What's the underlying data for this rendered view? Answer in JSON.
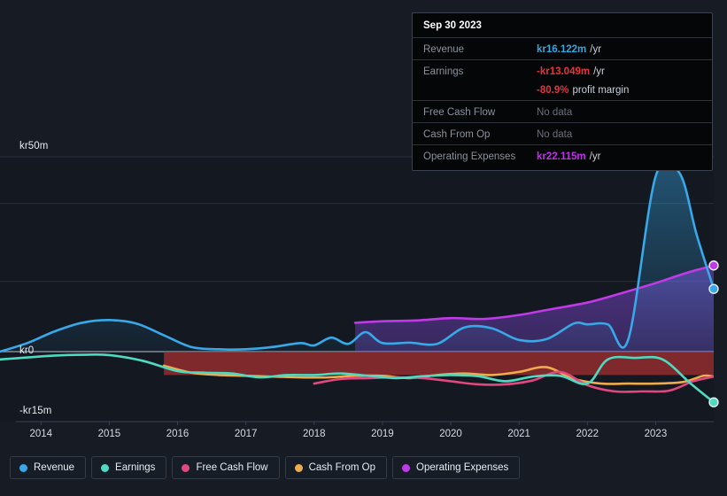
{
  "tooltip": {
    "date": "Sep 30 2023",
    "rows": [
      {
        "key": "Revenue",
        "value": "kr16.122m",
        "suffix": "/yr",
        "color": "#33a7e0",
        "nodata": false
      },
      {
        "key": "Earnings",
        "value": "-kr13.049m",
        "suffix": "/yr",
        "color": "#e8323c",
        "nodata": false
      },
      {
        "key": "",
        "value": "-80.9%",
        "suffix": "profit margin",
        "color": "#e8323c",
        "nodata": false,
        "continuation": true
      },
      {
        "key": "Free Cash Flow",
        "value": "No data",
        "suffix": "",
        "color": "#6a717b",
        "nodata": true
      },
      {
        "key": "Cash From Op",
        "value": "No data",
        "suffix": "",
        "color": "#6a717b",
        "nodata": true
      },
      {
        "key": "Operating Expenses",
        "value": "kr22.115m",
        "suffix": "/yr",
        "color": "#c030e8",
        "nodata": false
      }
    ]
  },
  "legend": [
    {
      "label": "Revenue",
      "color": "#38a8e8"
    },
    {
      "label": "Earnings",
      "color": "#4fd9c0"
    },
    {
      "label": "Free Cash Flow",
      "color": "#e0487f"
    },
    {
      "label": "Cash From Op",
      "color": "#eeac4d"
    },
    {
      "label": "Operating Expenses",
      "color": "#c13ae8"
    }
  ],
  "chart_data": {
    "type": "line",
    "title": "",
    "xlabel": "",
    "ylabel": "",
    "currency": "kr",
    "units": "millions",
    "grid": true,
    "legend_position": "bottom",
    "ylim": [
      -15,
      50
    ],
    "ytick_labels": [
      "kr50m",
      "kr0",
      "-kr15m"
    ],
    "ytick_values": [
      50,
      0,
      -15
    ],
    "gridline_values": [
      50,
      38,
      18,
      0
    ],
    "zero_line": 0,
    "xlim": [
      2013.4,
      2023.85
    ],
    "xtick_labels": [
      "2014",
      "2015",
      "2016",
      "2017",
      "2018",
      "2019",
      "2020",
      "2021",
      "2022",
      "2023"
    ],
    "xtick_values": [
      2014,
      2015,
      2016,
      2017,
      2018,
      2019,
      2020,
      2021,
      2022,
      2023
    ],
    "series": [
      {
        "name": "Revenue",
        "color": "#38a8e8",
        "fill": true,
        "x": [
          2013.4,
          2013.8,
          2014.2,
          2014.6,
          2015.0,
          2015.4,
          2015.8,
          2016.2,
          2016.6,
          2017.0,
          2017.4,
          2017.8,
          2018.0,
          2018.25,
          2018.5,
          2018.75,
          2019.0,
          2019.4,
          2019.8,
          2020.2,
          2020.6,
          2021.0,
          2021.4,
          2021.8,
          2022.0,
          2022.3,
          2022.6,
          2023.0,
          2023.35,
          2023.6,
          2023.85
        ],
        "y": [
          0.0,
          2.2,
          5.2,
          7.4,
          8.1,
          7.2,
          4.2,
          1.2,
          0.6,
          0.6,
          1.2,
          2.2,
          1.6,
          3.6,
          2.0,
          5.0,
          2.2,
          2.3,
          2.0,
          6.2,
          6.0,
          3.0,
          3.2,
          7.2,
          7.0,
          7.0,
          3.2,
          45.0,
          45.8,
          30.0,
          16.1
        ]
      },
      {
        "name": "Earnings",
        "color": "#4fd9c0",
        "fill": false,
        "x": [
          2013.4,
          2013.8,
          2014.2,
          2014.6,
          2015.0,
          2015.5,
          2016.0,
          2016.4,
          2016.8,
          2017.2,
          2017.6,
          2018.0,
          2018.4,
          2018.8,
          2019.2,
          2019.6,
          2020.0,
          2020.4,
          2020.8,
          2021.2,
          2021.6,
          2022.0,
          2022.3,
          2022.7,
          2023.1,
          2023.5,
          2023.85
        ],
        "y": [
          -2.0,
          -1.5,
          -1.0,
          -0.8,
          -0.9,
          -2.4,
          -5.0,
          -5.4,
          -5.6,
          -6.6,
          -6.0,
          -6.0,
          -5.6,
          -6.2,
          -6.8,
          -6.3,
          -6.0,
          -6.3,
          -7.6,
          -6.4,
          -6.2,
          -8.2,
          -2.0,
          -1.6,
          -2.0,
          -8.0,
          -13.0
        ]
      },
      {
        "name": "Free Cash Flow",
        "color": "#e0487f",
        "fill": false,
        "x": [
          2018.0,
          2018.4,
          2018.8,
          2019.2,
          2019.6,
          2020.0,
          2020.4,
          2020.8,
          2021.2,
          2021.6,
          2022.0,
          2022.4,
          2022.8,
          2023.2,
          2023.55,
          2023.85
        ],
        "y": [
          -8.2,
          -7.0,
          -6.8,
          -6.6,
          -6.8,
          -7.6,
          -8.4,
          -8.4,
          -7.4,
          -5.2,
          -8.6,
          -10.2,
          -10.2,
          -10.0,
          -7.6,
          -6.4
        ]
      },
      {
        "name": "Cash From Op",
        "color": "#eeac4d",
        "fill": false,
        "x": [
          2015.8,
          2016.2,
          2016.6,
          2017.0,
          2017.4,
          2017.8,
          2018.2,
          2018.6,
          2019.0,
          2019.4,
          2019.8,
          2020.2,
          2020.6,
          2021.0,
          2021.4,
          2021.8,
          2022.2,
          2022.6,
          2023.0,
          2023.4,
          2023.7,
          2023.85
        ],
        "y": [
          -3.6,
          -5.4,
          -6.0,
          -6.2,
          -6.4,
          -6.6,
          -6.6,
          -6.2,
          -6.2,
          -6.8,
          -6.0,
          -5.6,
          -6.0,
          -5.2,
          -4.0,
          -7.0,
          -8.2,
          -8.2,
          -8.2,
          -7.8,
          -6.2,
          -6.4
        ]
      },
      {
        "name": "Operating Expenses",
        "color": "#c13ae8",
        "fill": true,
        "x": [
          2018.6,
          2019.0,
          2019.5,
          2020.0,
          2020.5,
          2021.0,
          2021.5,
          2022.0,
          2022.5,
          2023.0,
          2023.45,
          2023.85
        ],
        "y": [
          7.4,
          7.8,
          8.0,
          8.6,
          8.4,
          9.4,
          11.0,
          12.6,
          15.0,
          17.6,
          20.2,
          22.1
        ]
      }
    ],
    "end_markers": [
      {
        "series": "Operating Expenses",
        "x": 2023.85,
        "y": 22.1,
        "color": "#c13ae8"
      },
      {
        "series": "Revenue",
        "x": 2023.85,
        "y": 16.1,
        "color": "#38a8e8"
      },
      {
        "series": "Earnings",
        "x": 2023.85,
        "y": -13.0,
        "color": "#4fd9c0"
      }
    ],
    "negative_band": {
      "from_x": 2015.8,
      "to_x": 2023.85,
      "top": 0,
      "bottom": -6.0,
      "color": "#a93030"
    }
  }
}
